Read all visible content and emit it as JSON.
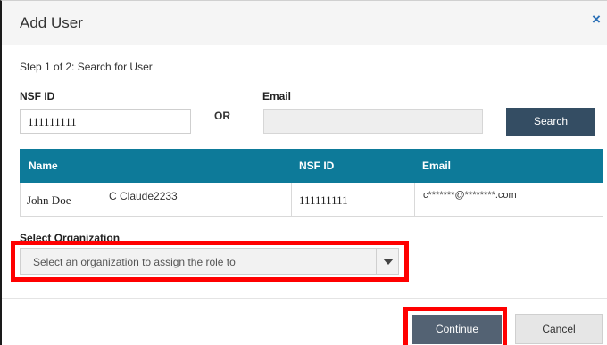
{
  "dialog": {
    "title": "Add User",
    "close_glyph": "×",
    "close_icon": "close-icon"
  },
  "step": {
    "text": "Step 1 of 2: Search for User"
  },
  "search": {
    "nsf_label": "NSF ID",
    "nsf_value": "111111111",
    "or_text": "OR",
    "email_label": "Email",
    "email_value": "",
    "search_label": "Search"
  },
  "results": {
    "headers": [
      "Name",
      "NSF ID",
      "Email"
    ],
    "rows": [
      {
        "name_first": "John Doe",
        "name_second": "C Claude2233",
        "nsf_id": "111111111",
        "email": "c*******@********.com"
      }
    ]
  },
  "organization": {
    "label": "Select Organization",
    "placeholder": "Select an organization to assign the role to",
    "arrow_icon": "caret-down-icon"
  },
  "footer": {
    "continue_label": "Continue",
    "cancel_label": "Cancel"
  },
  "colors": {
    "header_bg": "#f5f5f5",
    "table_header": "#0d7a99",
    "search_button": "#344d63",
    "continue_button": "#536273",
    "close_icon": "#2a6fb6",
    "highlight": "#ff0000"
  }
}
